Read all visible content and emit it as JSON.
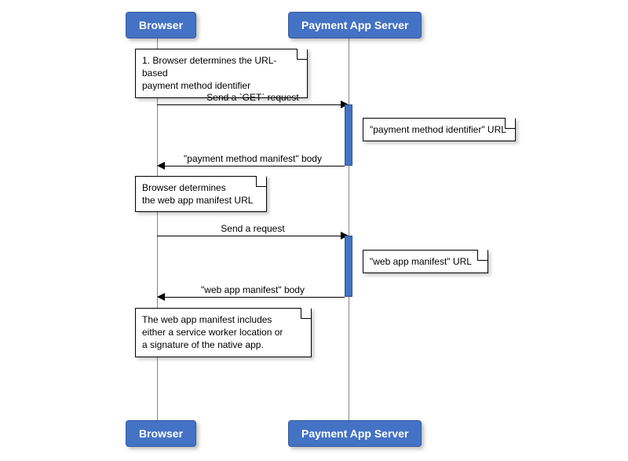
{
  "participants": {
    "browser": "Browser",
    "server": "Payment App Server"
  },
  "notes": {
    "n1": "1. Browser determines the URL-based\npayment method identifier",
    "n2": "\"payment method identifier\" URL",
    "n3": "Browser determines\nthe web app manifest URL",
    "n4": "\"web app manifest\" URL",
    "n5": "The web app manifest includes\neither a service worker location or\na signature of the native app."
  },
  "messages": {
    "m1": "Send a `GET` request",
    "m2": "\"payment method manifest\" body",
    "m3": "Send a request",
    "m4": "\"web app manifest\" body"
  }
}
